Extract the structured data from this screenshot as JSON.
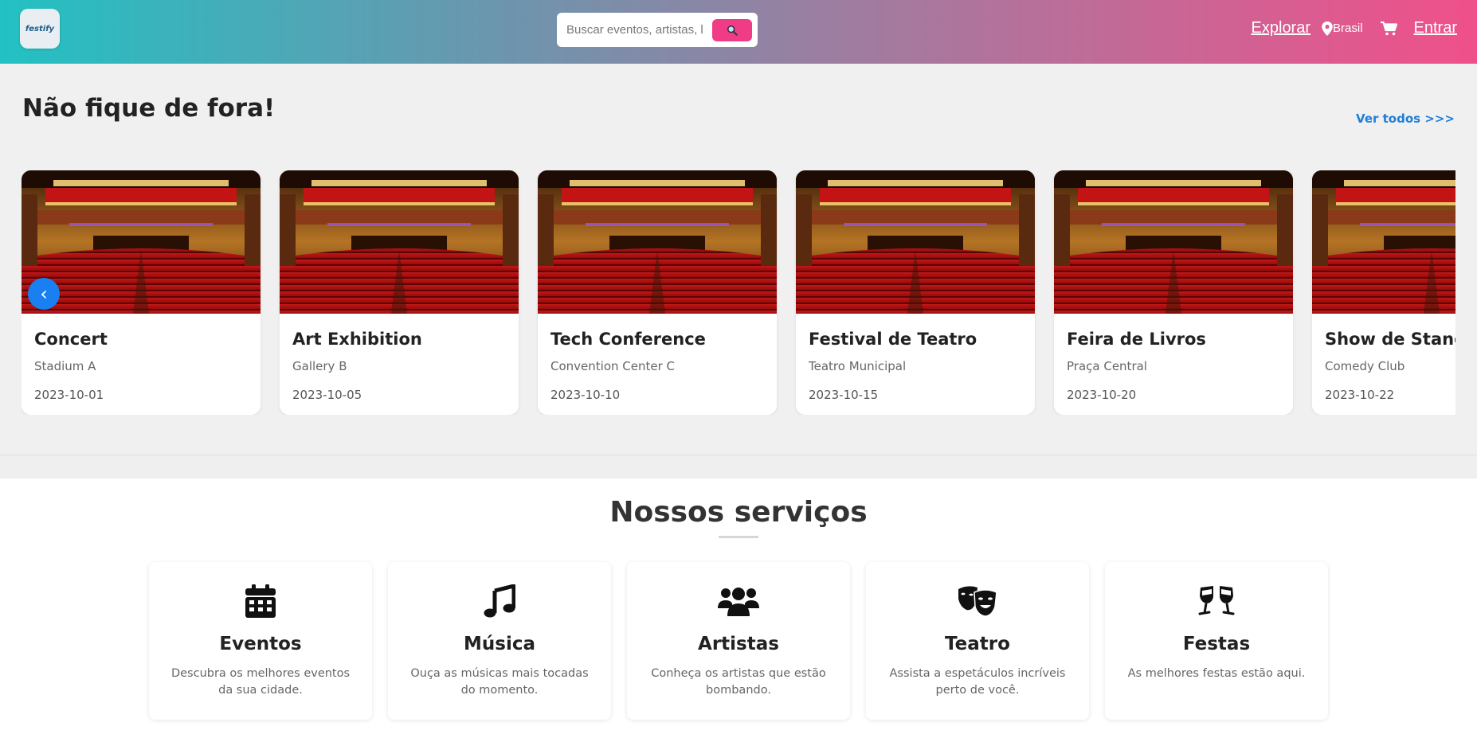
{
  "header": {
    "logo_text": "festify",
    "search_placeholder": "Buscar eventos, artistas, l",
    "nav_explore": "Explorar",
    "nav_location": "Brasil",
    "nav_login": "Entrar",
    "gradient": [
      "#22c1c3",
      "#f0508a"
    ]
  },
  "hero": {
    "title": "Não fique de fora!",
    "see_all": "Ver todos >>>",
    "events": [
      {
        "title": "Concert",
        "place": "Stadium A",
        "date": "2023-10-01"
      },
      {
        "title": "Art Exhibition",
        "place": "Gallery B",
        "date": "2023-10-05"
      },
      {
        "title": "Tech Conference",
        "place": "Convention Center C",
        "date": "2023-10-10"
      },
      {
        "title": "Festival de Teatro",
        "place": "Teatro Municipal",
        "date": "2023-10-15"
      },
      {
        "title": "Feira de Livros",
        "place": "Praça Central",
        "date": "2023-10-20"
      },
      {
        "title": "Show de Stand-up",
        "place": "Comedy Club",
        "date": "2023-10-22"
      }
    ],
    "prev_arrow": "‹"
  },
  "services": {
    "title": "Nossos serviços",
    "items": [
      {
        "icon": "calendar-icon",
        "title": "Eventos",
        "desc": "Descubra os melhores eventos da sua cidade."
      },
      {
        "icon": "music-icon",
        "title": "Música",
        "desc": "Ouça as músicas mais tocadas do momento."
      },
      {
        "icon": "users-icon",
        "title": "Artistas",
        "desc": "Conheça os artistas que estão bombando."
      },
      {
        "icon": "theater-masks-icon",
        "title": "Teatro",
        "desc": "Assista a espetáculos incríveis perto de você."
      },
      {
        "icon": "glasses-cheers-icon",
        "title": "Festas",
        "desc": "As melhores festas estão aqui."
      }
    ]
  },
  "colors": {
    "accent_pink": "#f03c87",
    "link_blue": "#1e7fd8",
    "arrow_blue": "#1a7ff0"
  }
}
